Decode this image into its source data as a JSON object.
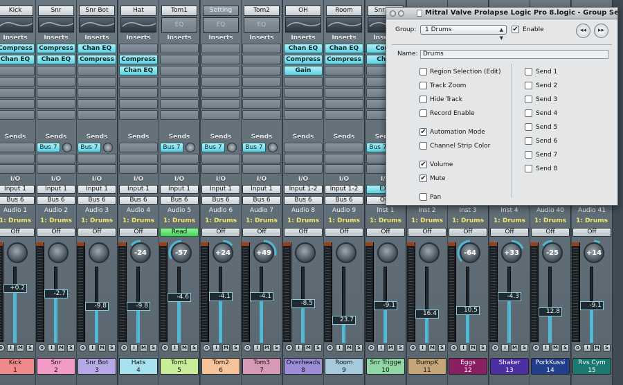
{
  "mixer": {
    "inserts_label": "Inserts",
    "sends_label": "Sends",
    "io_label": "I/O",
    "btn_labels": {
      "mute": "M",
      "solo": "S",
      "input": "I",
      "record": "R"
    },
    "channels": [
      {
        "top": "Kick",
        "eq": "graph",
        "plugins": [
          "Compress",
          "Chan EQ"
        ],
        "send": "",
        "io_in": "Input 1",
        "io_out": "Bus 6",
        "track": "Audio 1",
        "group": "1: Drums",
        "auto": "Off",
        "pan": "",
        "vol": "+0.2",
        "vol_pct": 0.7,
        "bottom": "Kick",
        "num": "1",
        "color": "#f08a8a"
      },
      {
        "top": "Snr",
        "eq": "graph",
        "plugins": [
          "Compress",
          "Chan EQ"
        ],
        "send": "Bus 7",
        "io_in": "Input 1",
        "io_out": "Bus 6",
        "track": "Audio 2",
        "group": "1: Drums",
        "auto": "Off",
        "pan": "",
        "vol": "-2.7",
        "vol_pct": 0.63,
        "bottom": "Snr",
        "num": "2",
        "color": "#f19cc8"
      },
      {
        "top": "Snr Bot",
        "eq": "graph",
        "plugins": [
          "Chan EQ",
          "Compress"
        ],
        "send": "Bus 7",
        "io_in": "Input 1",
        "io_out": "Bus 6",
        "track": "Audio 3",
        "group": "1: Drums",
        "auto": "Off",
        "pan": "",
        "vol": "-9.8",
        "vol_pct": 0.46,
        "bottom": "Snr Bot",
        "num": "3",
        "color": "#b7a9e8"
      },
      {
        "top": "Hat",
        "eq": "graph",
        "plugins": [
          "",
          "Compress",
          "Chan EQ"
        ],
        "send": "",
        "io_in": "Input 1",
        "io_out": "Bus 6",
        "track": "Audio 4",
        "group": "1: Drums",
        "auto": "Off",
        "pan": "-24",
        "vol": "-9.8",
        "vol_pct": 0.46,
        "bottom": "Hats",
        "num": "4",
        "color": "#a8e2ef"
      },
      {
        "top": "Tom1",
        "eq": "flat",
        "plugins": [],
        "send": "Bus 7",
        "io_in": "Input 1",
        "io_out": "Bus 6",
        "track": "Audio 5",
        "group": "1: Drums",
        "auto": "Read",
        "pan": "-57",
        "vol": "-4.6",
        "vol_pct": 0.58,
        "bottom": "Tom1",
        "num": "5",
        "color": "#c9ec9a"
      },
      {
        "top": "Setting",
        "eq": "flat",
        "plugins": [],
        "send": "Bus 7",
        "io_in": "Input 1",
        "io_out": "Bus 6",
        "track": "Audio 6",
        "group": "1: Drums",
        "auto": "Off",
        "pan": "+24",
        "vol": "-4.1",
        "vol_pct": 0.59,
        "bottom": "Tom2",
        "num": "6",
        "color": "#f5c39a"
      },
      {
        "top": "Tom2",
        "eq": "flat",
        "plugins": [],
        "send": "Bus 7",
        "io_in": "Input 1",
        "io_out": "Bus 6",
        "track": "Audio 7",
        "group": "1: Drums",
        "auto": "Off",
        "pan": "+49",
        "vol": "-4.1",
        "vol_pct": 0.59,
        "bottom": "Tom3",
        "num": "7",
        "color": "#d69ab6"
      },
      {
        "top": "OH",
        "eq": "graph",
        "plugins": [
          "Chan EQ",
          "Compress",
          "Gain"
        ],
        "send": "",
        "io_in": "Input 1-2",
        "io_out": "Bus 6",
        "track": "Audio 8",
        "group": "1: Drums",
        "auto": "Off",
        "pan": "",
        "vol": "-8.5",
        "vol_pct": 0.5,
        "bottom": "Overheads",
        "num": "8",
        "color": "#9b8dd8"
      },
      {
        "top": "Room",
        "eq": "graph",
        "plugins": [
          "Chan EQ",
          "Compress"
        ],
        "send": "",
        "io_in": "Input 1-2",
        "io_out": "Bus 6",
        "track": "Audio 9",
        "group": "1: Drums",
        "auto": "Off",
        "pan": "",
        "vol": "23.7",
        "vol_pct": 0.28,
        "bottom": "Room",
        "num": "9",
        "color": "#a6c9dc"
      },
      {
        "top": "Snr Sm",
        "eq": "graph",
        "plugins": [
          "Comp",
          "Chan"
        ],
        "send": "Bus 7",
        "io_in": "EXS",
        "io_out": "Out",
        "track": "Inst 1",
        "group": "1: Drums",
        "auto": "Off",
        "pan": "",
        "vol": "-9.1",
        "vol_pct": 0.47,
        "bottom": "Snr Trigge",
        "num": "10",
        "color": "#8fd6a4"
      },
      {
        "top": "",
        "eq": "none",
        "plugins": [],
        "send": "",
        "io_in": "",
        "io_out": "",
        "track": "Inst 2",
        "group": "1: Drums",
        "auto": "Off",
        "pan": "",
        "vol": "16.4",
        "vol_pct": 0.36,
        "bottom": "BumpK",
        "num": "11",
        "color": "#c5a579"
      },
      {
        "top": "",
        "eq": "none",
        "plugins": [],
        "send": "",
        "io_in": "",
        "io_out": "",
        "track": "Inst 3",
        "group": "1: Drums",
        "auto": "Off",
        "pan": "-64",
        "vol": "10.5",
        "vol_pct": 0.41,
        "bottom": "Eggs",
        "num": "12",
        "color": "#8a1e62"
      },
      {
        "top": "",
        "eq": "none",
        "plugins": [],
        "send": "",
        "io_in": "",
        "io_out": "",
        "track": "Inst 4",
        "group": "1: Drums",
        "auto": "Off",
        "pan": "+33",
        "vol": "-4.3",
        "vol_pct": 0.59,
        "bottom": "Shaker",
        "num": "13",
        "color": "#4b2fa3"
      },
      {
        "top": "",
        "eq": "none",
        "plugins": [],
        "send": "",
        "io_in": "",
        "io_out": "",
        "track": "Audio 40",
        "group": "1: Drums",
        "auto": "Off",
        "pan": "-25",
        "vol": "12.8",
        "vol_pct": 0.39,
        "bottom": "PorkKussi",
        "num": "14",
        "color": "#233e8a"
      },
      {
        "top": "",
        "eq": "none",
        "plugins": [],
        "send": "",
        "io_in": "",
        "io_out": "",
        "track": "Audio 41",
        "group": "1: Drums",
        "auto": "Off",
        "pan": "+14",
        "vol": "-9.1",
        "vol_pct": 0.47,
        "bottom": "Rvs Cym",
        "num": "15",
        "color": "#1b7a6f"
      }
    ]
  },
  "dialog": {
    "title": "Mitral Valve Prolapse Logic Pro 8.logic - Group Settings",
    "group_label": "Group:",
    "group_value": "1 Drums",
    "enable_label": "Enable",
    "enable_checked": true,
    "name_label": "Name:",
    "name_value": "Drums",
    "options_left": [
      {
        "label": "Region Selection (Edit)",
        "checked": false
      },
      {
        "label": "Track Zoom",
        "checked": false
      },
      {
        "label": "Hide Track",
        "checked": false
      },
      {
        "label": "Record Enable",
        "checked": false
      },
      {
        "label": "Automation Mode",
        "checked": true
      },
      {
        "label": "Channel Strip Color",
        "checked": false
      },
      {
        "label": "Volume",
        "checked": true
      },
      {
        "label": "Mute",
        "checked": true
      },
      {
        "label": "Pan",
        "checked": false
      }
    ],
    "options_right": [
      {
        "label": "Send 1",
        "checked": false
      },
      {
        "label": "Send 2",
        "checked": false
      },
      {
        "label": "Send 3",
        "checked": false
      },
      {
        "label": "Send 4",
        "checked": false
      },
      {
        "label": "Send 5",
        "checked": false
      },
      {
        "label": "Send 6",
        "checked": false
      },
      {
        "label": "Send 7",
        "checked": false
      },
      {
        "label": "Send 8",
        "checked": false
      }
    ]
  }
}
